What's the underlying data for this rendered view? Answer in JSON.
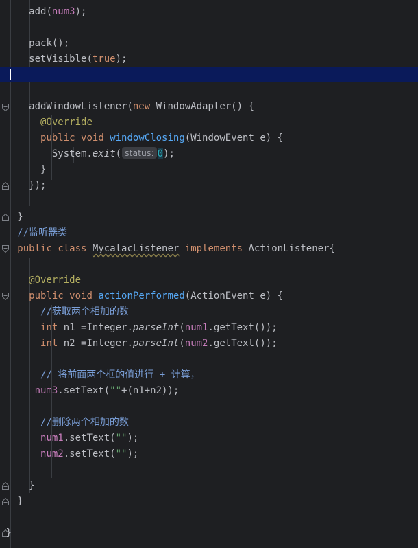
{
  "editor": {
    "lines": {
      "l01": {
        "indent": "     ",
        "a": "add(",
        "b": "num3",
        "c": ");"
      },
      "l02": {
        "indent": "     ",
        "a": "pack();"
      },
      "l03": {
        "indent": "     ",
        "a": "setVisible(",
        "b": "true",
        "c": ");"
      },
      "l04": {
        "indent": "     ",
        "a": "addWindowListener(",
        "b": "new",
        "c": " WindowAdapter() {"
      },
      "l05": {
        "indent": "       ",
        "a": "@Override"
      },
      "l06": {
        "indent": "       ",
        "a": "public",
        "b": " ",
        "c": "void",
        "d": " ",
        "e": "windowClosing",
        "f": "(WindowEvent e) {"
      },
      "l07": {
        "indent": "         ",
        "a": "System.",
        "b": "exit",
        "c": "(",
        "hint": "status:",
        "d": "0",
        "e": ");"
      },
      "l08": {
        "indent": "       ",
        "a": "}"
      },
      "l09": {
        "indent": "     ",
        "a": "});"
      },
      "l10": {
        "indent": "   ",
        "a": "}"
      },
      "l11": {
        "indent": "   ",
        "a": "//监听器类"
      },
      "l12": {
        "indent": "   ",
        "a": "public",
        "b": " ",
        "c": "class",
        "d": " ",
        "e": "MycalacListener",
        "f": " ",
        "g": "implements",
        "h": " ActionListener{"
      },
      "l13": {
        "indent": "     ",
        "a": "@Override"
      },
      "l14": {
        "indent": "     ",
        "a": "public",
        "b": " ",
        "c": "void",
        "d": " ",
        "e": "actionPerformed",
        "f": "(ActionEvent e) {"
      },
      "l15": {
        "indent": "       ",
        "a": "//获取两个相加的数"
      },
      "l16": {
        "indent": "       ",
        "a": "int",
        "b": " n1 =Integer.",
        "c": "parseInt",
        "d": "(",
        "e": "num1",
        "f": ".getText());"
      },
      "l17": {
        "indent": "       ",
        "a": "int",
        "b": " n2 =Integer.",
        "c": "parseInt",
        "d": "(",
        "e": "num2",
        "f": ".getText());"
      },
      "l18": {
        "indent": "       ",
        "a": "// 将前面两个框的值进行 + 计算，"
      },
      "l19": {
        "indent": "      ",
        "a": "num3",
        "b": ".setText(",
        "c": "\"\"",
        "d": "+(n1+n2));"
      },
      "l20": {
        "indent": "       ",
        "a": "//删除两个相加的数"
      },
      "l21": {
        "indent": "       ",
        "a": "num1",
        "b": ".setText(",
        "c": "\"\"",
        "d": ");"
      },
      "l22": {
        "indent": "       ",
        "a": "num2",
        "b": ".setText(",
        "c": "\"\"",
        "d": ");"
      },
      "l23": {
        "indent": "     ",
        "a": "}"
      },
      "l24": {
        "indent": "   ",
        "a": "}"
      },
      "l25": {
        "indent": " ",
        "a": "}"
      }
    }
  },
  "colors": {
    "background": "#1e1f22",
    "current_line": "#0a1a5a",
    "text": "#bcbec4",
    "keyword": "#cf8e6d",
    "method": "#56a8f5",
    "field": "#c77dbb",
    "annotation": "#b3ae60",
    "string": "#6aab73",
    "number": "#2aacb8",
    "comment": "#7a9fd8"
  }
}
